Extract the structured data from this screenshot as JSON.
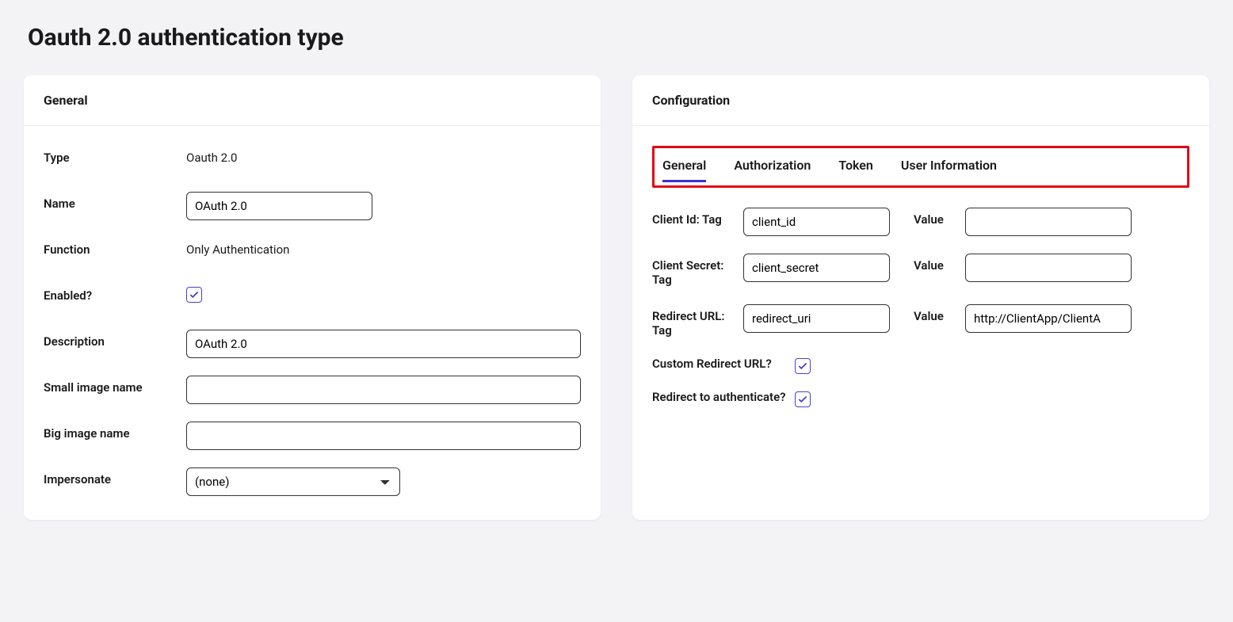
{
  "page_title": "Oauth 2.0 authentication type",
  "general_card": {
    "header": "General",
    "type_label": "Type",
    "type_value": "Oauth 2.0",
    "name_label": "Name",
    "name_value": "OAuth 2.0",
    "function_label": "Function",
    "function_value": "Only Authentication",
    "enabled_label": "Enabled?",
    "enabled_checked": true,
    "description_label": "Description",
    "description_value": "OAuth 2.0",
    "small_image_label": "Small image name",
    "small_image_value": "",
    "big_image_label": "Big image name",
    "big_image_value": "",
    "impersonate_label": "Impersonate",
    "impersonate_selected": "(none)"
  },
  "config_card": {
    "header": "Configuration",
    "tabs": [
      "General",
      "Authorization",
      "Token",
      "User Information"
    ],
    "active_tab": "General",
    "client_id_tag_label": "Client Id: Tag",
    "client_id_tag_value": "client_id",
    "client_id_value_label": "Value",
    "client_id_value": "",
    "client_id_value_redacted": true,
    "client_secret_tag_label": "Client Secret: Tag",
    "client_secret_tag_value": "client_secret",
    "client_secret_value_label": "Value",
    "client_secret_value": "",
    "client_secret_value_redacted": true,
    "redirect_url_tag_label": "Redirect URL: Tag",
    "redirect_url_tag_value": "redirect_uri",
    "redirect_url_value_label": "Value",
    "redirect_url_value": "http://ClientApp/ClientA",
    "custom_redirect_label": "Custom Redirect URL?",
    "custom_redirect_checked": true,
    "redirect_auth_label": "Redirect to authenticate?",
    "redirect_auth_checked": true
  }
}
